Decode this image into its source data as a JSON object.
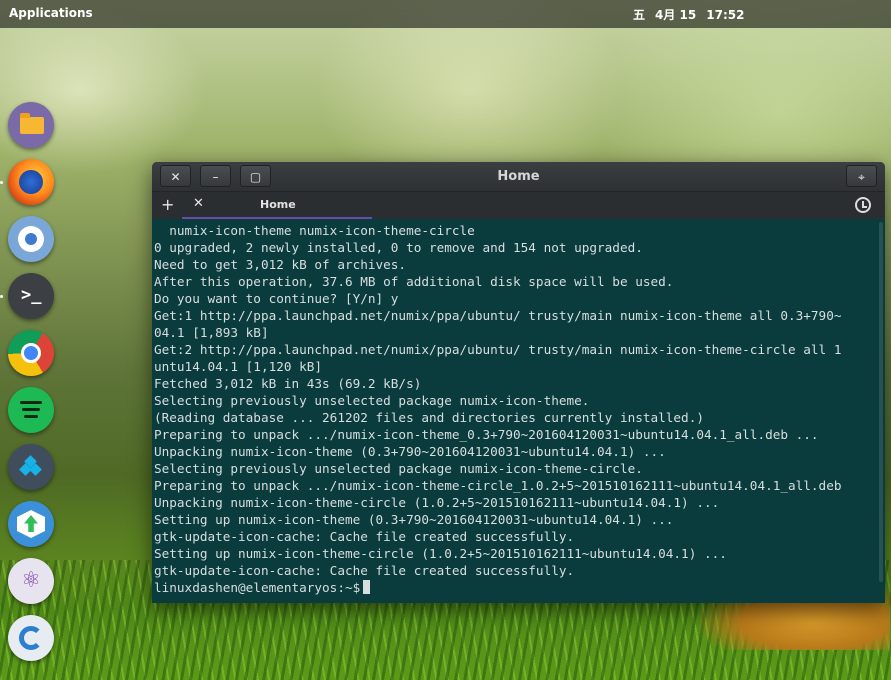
{
  "top_panel": {
    "applications_label": "Applications",
    "date_day": "五",
    "date_month_day": "4月 15",
    "time": "17:52"
  },
  "dock": {
    "items": [
      {
        "name": "files",
        "icon": "folder-icon"
      },
      {
        "name": "firefox",
        "icon": "firefox-icon"
      },
      {
        "name": "chromium",
        "icon": "chromium-icon"
      },
      {
        "name": "terminal",
        "icon": "terminal-icon",
        "glyph": ">_"
      },
      {
        "name": "chrome",
        "icon": "chrome-icon"
      },
      {
        "name": "spotify",
        "icon": "spotify-icon"
      },
      {
        "name": "kodi",
        "icon": "kodi-icon"
      },
      {
        "name": "update",
        "icon": "update-icon"
      },
      {
        "name": "atom",
        "icon": "atom-icon",
        "glyph": "⚛"
      },
      {
        "name": "app",
        "icon": "app-icon"
      }
    ]
  },
  "window": {
    "title": "Home",
    "close_glyph": "✕",
    "minimize_glyph": "–",
    "maximize_glyph": "▢",
    "menu_glyph": "⌖",
    "tab": {
      "label": "Home",
      "close_glyph": "✕",
      "add_glyph": "+"
    },
    "accent_color": "#6b4ba8"
  },
  "terminal": {
    "background": "#0a3b3d",
    "lines": [
      "  numix-icon-theme numix-icon-theme-circle",
      "0 upgraded, 2 newly installed, 0 to remove and 154 not upgraded.",
      "Need to get 3,012 kB of archives.",
      "After this operation, 37.6 MB of additional disk space will be used.",
      "Do you want to continue? [Y/n] y",
      "Get:1 http://ppa.launchpad.net/numix/ppa/ubuntu/ trusty/main numix-icon-theme all 0.3+790~",
      "04.1 [1,893 kB]",
      "Get:2 http://ppa.launchpad.net/numix/ppa/ubuntu/ trusty/main numix-icon-theme-circle all 1",
      "untu14.04.1 [1,120 kB]",
      "Fetched 3,012 kB in 43s (69.2 kB/s)",
      "Selecting previously unselected package numix-icon-theme.",
      "(Reading database ... 261202 files and directories currently installed.)",
      "Preparing to unpack .../numix-icon-theme_0.3+790~201604120031~ubuntu14.04.1_all.deb ...",
      "Unpacking numix-icon-theme (0.3+790~201604120031~ubuntu14.04.1) ...",
      "Selecting previously unselected package numix-icon-theme-circle.",
      "Preparing to unpack .../numix-icon-theme-circle_1.0.2+5~201510162111~ubuntu14.04.1_all.deb",
      "Unpacking numix-icon-theme-circle (1.0.2+5~201510162111~ubuntu14.04.1) ...",
      "Setting up numix-icon-theme (0.3+790~201604120031~ubuntu14.04.1) ...",
      "gtk-update-icon-cache: Cache file created successfully.",
      "Setting up numix-icon-theme-circle (1.0.2+5~201510162111~ubuntu14.04.1) ...",
      "gtk-update-icon-cache: Cache file created successfully."
    ],
    "prompt": "linuxdashen@elementaryos:~$"
  }
}
